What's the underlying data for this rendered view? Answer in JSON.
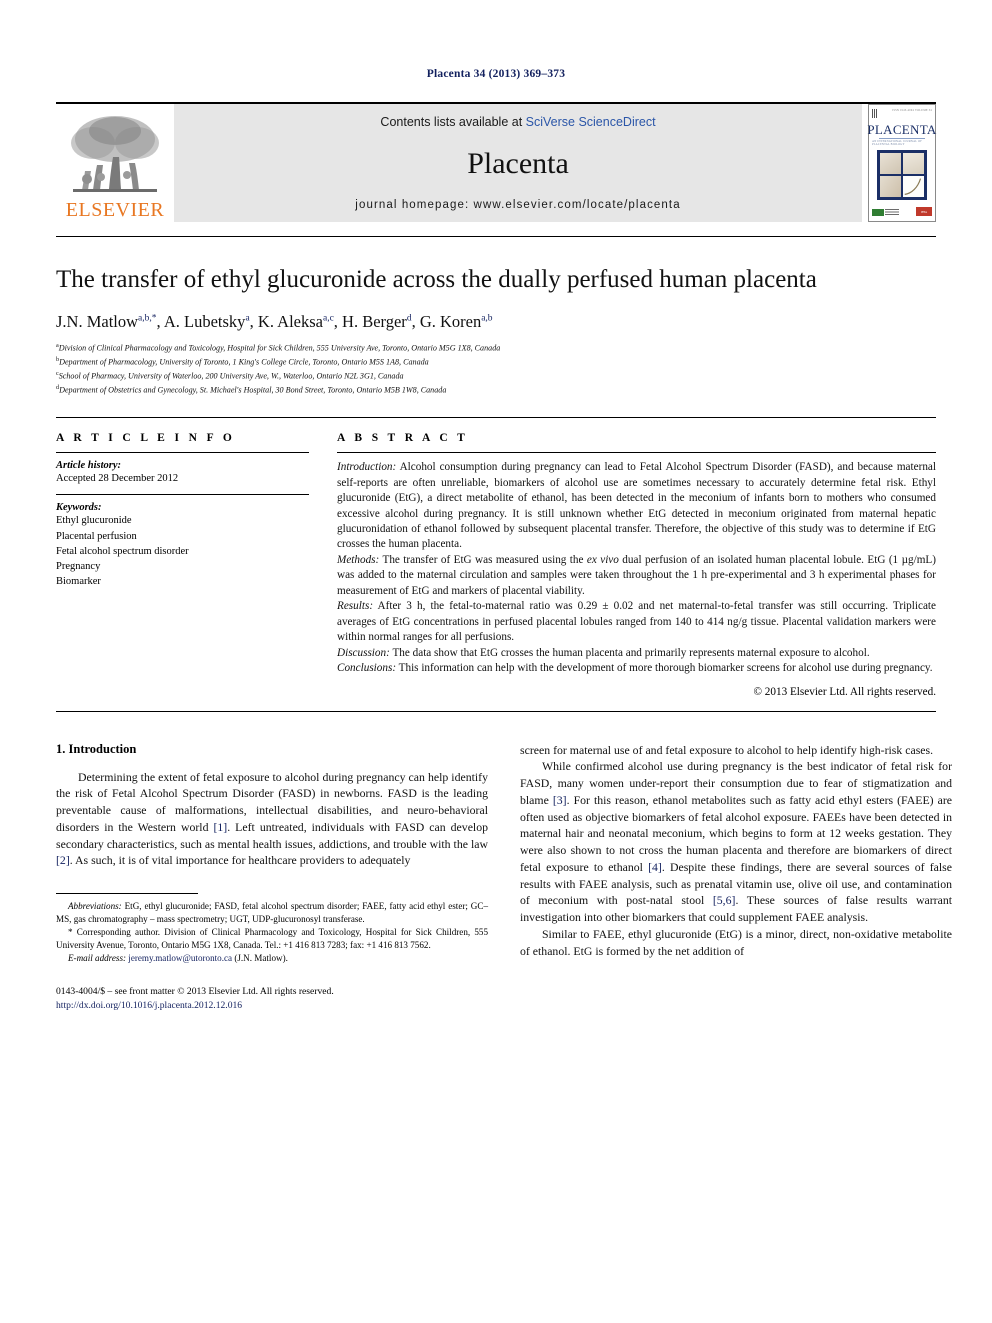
{
  "running_head": "Placenta 34 (2013) 369–373",
  "masthead": {
    "publisher_name": "ELSEVIER",
    "contents_prefix": "Contents lists available at ",
    "contents_link": "SciVerse ScienceDirect",
    "journal_name": "Placenta",
    "homepage_line": "journal homepage: www.elsevier.com/locate/placenta",
    "cover_title": "PLACENTA",
    "cover_subtitle": "AN INTERNATIONAL JOURNAL OF PLACENTAL BIOLOGY",
    "cover_topnote": "ISSN 0143-4004   VOLUME 34"
  },
  "article": {
    "title": "The transfer of ethyl glucuronide across the dually perfused human placenta",
    "authors_html": "J.N. Matlow<sup>a,b,*</sup>, A. Lubetsky<sup>a</sup>, K. Aleksa<sup>a,c</sup>, H. Berger<sup>d</sup>, G. Koren<sup>a,b</sup>",
    "affiliations": [
      {
        "mark": "a",
        "text": "Division of Clinical Pharmacology and Toxicology, Hospital for Sick Children, 555 University Ave, Toronto, Ontario M5G 1X8, Canada"
      },
      {
        "mark": "b",
        "text": "Department of Pharmacology, University of Toronto, 1 King's College Circle, Toronto, Ontario M5S 1A8, Canada"
      },
      {
        "mark": "c",
        "text": "School of Pharmacy, University of Waterloo, 200 University Ave, W., Waterloo, Ontario N2L 3G1, Canada"
      },
      {
        "mark": "d",
        "text": "Department of Obstetrics and Gynecology, St. Michael's Hospital, 30 Bond Street, Toronto, Ontario M5B 1W8, Canada"
      }
    ]
  },
  "article_info": {
    "heading": "A R T I C L E   I N F O",
    "history_label": "Article history:",
    "history_value": "Accepted 28 December 2012",
    "keywords_label": "Keywords:",
    "keywords": [
      "Ethyl glucuronide",
      "Placental perfusion",
      "Fetal alcohol spectrum disorder",
      "Pregnancy",
      "Biomarker"
    ]
  },
  "abstract": {
    "heading": "A B S T R A C T",
    "sections": [
      {
        "label": "Introduction:",
        "text": " Alcohol consumption during pregnancy can lead to Fetal Alcohol Spectrum Disorder (FASD), and because maternal self-reports are often unreliable, biomarkers of alcohol use are sometimes necessary to accurately determine fetal risk. Ethyl glucuronide (EtG), a direct metabolite of ethanol, has been detected in the meconium of infants born to mothers who consumed excessive alcohol during pregnancy. It is still unknown whether EtG detected in meconium originated from maternal hepatic glucuronidation of ethanol followed by subsequent placental transfer. Therefore, the objective of this study was to determine if EtG crosses the human placenta."
      },
      {
        "label": "Methods:",
        "text": " The transfer of EtG was measured using the ex vivo dual perfusion of an isolated human placental lobule. EtG (1 µg/mL) was added to the maternal circulation and samples were taken throughout the 1 h pre-experimental and 3 h experimental phases for measurement of EtG and markers of placental viability."
      },
      {
        "label": "Results:",
        "text": " After 3 h, the fetal-to-maternal ratio was 0.29 ± 0.02 and net maternal-to-fetal transfer was still occurring. Triplicate averages of EtG concentrations in perfused placental lobules ranged from 140 to 414 ng/g tissue. Placental validation markers were within normal ranges for all perfusions."
      },
      {
        "label": "Discussion:",
        "text": " The data show that EtG crosses the human placenta and primarily represents maternal exposure to alcohol."
      },
      {
        "label": "Conclusions:",
        "text": " This information can help with the development of more thorough biomarker screens for alcohol use during pregnancy."
      }
    ],
    "copyright": "© 2013 Elsevier Ltd. All rights reserved."
  },
  "body": {
    "section_number_title": "1.  Introduction",
    "left_paragraphs": [
      "Determining the extent of fetal exposure to alcohol during pregnancy can help identify the risk of Fetal Alcohol Spectrum Disorder (FASD) in newborns. FASD is the leading preventable cause of malformations, intellectual disabilities, and neuro-behavioral disorders in the Western world [1]. Left untreated, individuals with FASD can develop secondary characteristics, such as mental health issues, addictions, and trouble with the law [2]. As such, it is of vital importance for healthcare providers to adequately"
    ],
    "right_paragraphs": [
      "screen for maternal use of and fetal exposure to alcohol to help identify high-risk cases.",
      "While confirmed alcohol use during pregnancy is the best indicator of fetal risk for FASD, many women under-report their consumption due to fear of stigmatization and blame [3]. For this reason, ethanol metabolites such as fatty acid ethyl esters (FAEE) are often used as objective biomarkers of fetal alcohol exposure. FAEEs have been detected in maternal hair and neonatal meconium, which begins to form at 12 weeks gestation. They were also shown to not cross the human placenta and therefore are biomarkers of direct fetal exposure to ethanol [4]. Despite these findings, there are several sources of false results with FAEE analysis, such as prenatal vitamin use, olive oil use, and contamination of meconium with post-natal stool [5,6]. These sources of false results warrant investigation into other biomarkers that could supplement FAEE analysis.",
      "Similar to FAEE, ethyl glucuronide (EtG) is a minor, direct, non-oxidative metabolite of ethanol. EtG is formed by the net addition of"
    ]
  },
  "footnotes": {
    "abbreviations_label": "Abbreviations:",
    "abbreviations_text": " EtG, ethyl glucuronide; FASD, fetal alcohol spectrum disorder; FAEE, fatty acid ethyl ester; GC–MS, gas chromatography – mass spectrometry; UGT, UDP-glucuronosyl transferase.",
    "corresponding_text": "* Corresponding author. Division of Clinical Pharmacology and Toxicology, Hospital for Sick Children, 555 University Avenue, Toronto, Ontario M5G 1X8, Canada. Tel.: +1 416 813 7283; fax: +1 416 813 7562.",
    "email_label": "E-mail address:",
    "email_value": "jeremy.matlow@utoronto.ca",
    "email_suffix": " (J.N. Matlow).",
    "issn_line": "0143-4004/$ – see front matter © 2013 Elsevier Ltd. All rights reserved.",
    "doi_line": "http://dx.doi.org/10.1016/j.placenta.2012.12.016"
  },
  "colors": {
    "link_blue": "#12205e",
    "sciencedirect_blue": "#2b56a8",
    "elsevier_orange": "#e87722",
    "masthead_gray": "#e6e6e6"
  }
}
